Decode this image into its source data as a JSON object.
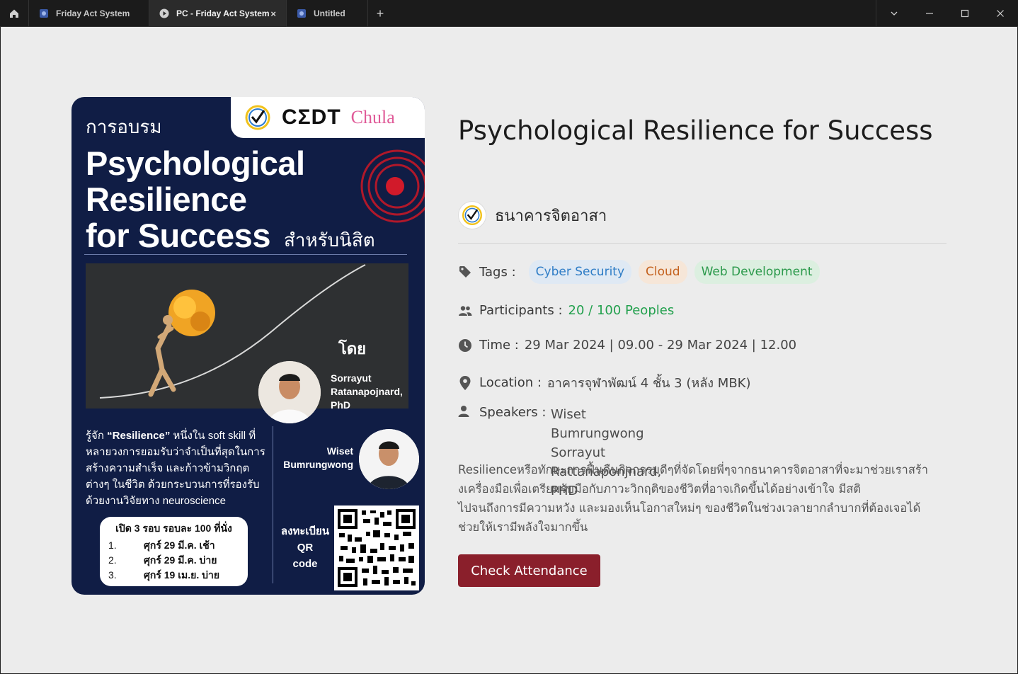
{
  "titlebar": {
    "tabs": [
      {
        "label": "Friday Act System",
        "active": false
      },
      {
        "label": "PC - Friday Act System",
        "active": true
      },
      {
        "label": "Untitled",
        "active": false
      }
    ],
    "new_tab_symbol": "+",
    "close_symbol": "×",
    "icons": [
      "home-icon",
      "chevron-down-icon",
      "minimize-icon",
      "maximize-icon",
      "close-icon"
    ]
  },
  "poster": {
    "logo_cedt": "CΣDT",
    "logo_chula": "Chula",
    "kicker": "การอบรม",
    "title_lines": [
      "Psychological",
      "Resilience",
      "for Success"
    ],
    "subtitle": "สำหรับนิสิต",
    "by_label": "โดย",
    "speaker1": [
      "Sorrayut",
      "Ratanapojnard,",
      "PhD"
    ],
    "speaker2": [
      "Wiset",
      "Bumrungwong"
    ],
    "description_prefix": "รู้จัก ",
    "description_bold": "“Resilience”",
    "description_rest": " หนึ่งใน soft skill ที่หลายวงการยอมรับว่าจำเป็นที่สุดในการสร้างความสำเร็จ และก้าวข้ามวิกฤตต่างๆ ในชีวิต ด้วยกระบวนการที่รองรับด้วยงานวิจัยทาง neuroscience",
    "rounds_title": "เปิด 3 รอบ รอบละ 100 ที่นั่ง",
    "rounds": [
      {
        "n": "1.",
        "text": "ศุกร์ 29 มี.ค. เช้า"
      },
      {
        "n": "2.",
        "text": "ศุกร์ 29 มี.ค. บ่าย"
      },
      {
        "n": "3.",
        "text": "ศุกร์ 19 เม.ย. บ่าย"
      }
    ],
    "register_lines": [
      "ลงทะเบียน",
      "QR",
      "code"
    ]
  },
  "event": {
    "title": "Psychological Resilience for Success",
    "organizer": "ธนาคารจิตอาสา",
    "tags_label": "Tags :",
    "tags": [
      "Cyber Security",
      "Cloud",
      "Web Development"
    ],
    "participants_label": "Participants :",
    "participants_value": "20 / 100 Peoples",
    "time_label": "Time :",
    "time_value": "29 Mar 2024 | 09.00 - 29 Mar 2024 | 12.00",
    "location_label": "Location :",
    "location_value": "อาคารจุฬาพัฒน์ 4 ชั้น 3 (หลัง MBK)",
    "speakers_label": "Speakers :",
    "speakers": [
      "Wiset Bumrungwong",
      "Sorrayut Rattanaponjnard, PHD"
    ],
    "description_lines": [
      "Resilienceหรือทักษะการฟื้นคืนกิจกรรมดีๆที่จัดโดยพี่ๆจากธนาคารจิตอาสาที่จะมาช่วยเราสร้า",
      "งเครื่องมือเพื่อเตรียมรับมือกับภาวะวิกฤติของชีวิตที่อาจเกิดขึ้นได้อย่างเข้าใจ มีสติ",
      "ไปจนถึงการมีความหวัง และมองเห็นโอกาสใหม่ๆ ของชีวิตในช่วงเวลายากลำบากที่ต้องเจอได้",
      "ช่วยให้เรามีพลังใจมากขึ้น"
    ],
    "check_button": "Check Attendance"
  },
  "colors": {
    "accent_button": "#8a1f2b",
    "poster_navy": "#101d45",
    "participants_green": "#22a04d",
    "tag_blue": "#2f7dc6",
    "tag_orange": "#c4621f",
    "tag_green": "#2c9a4c"
  }
}
